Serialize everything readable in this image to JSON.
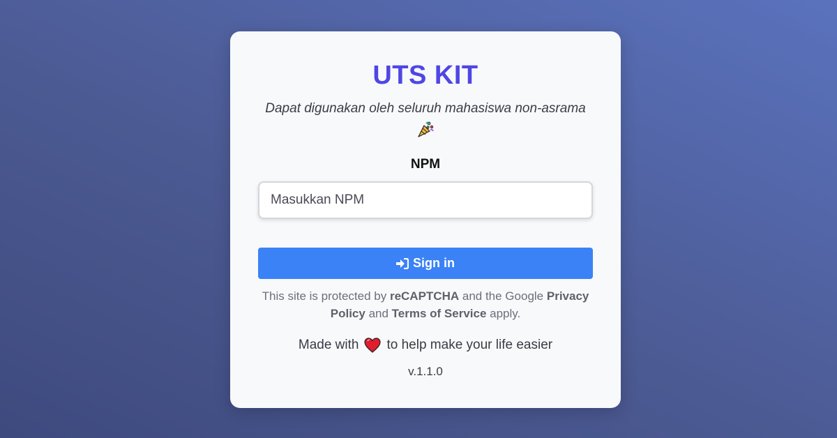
{
  "card": {
    "title": "UTS KIT",
    "subtitle": "Dapat digunakan oleh seluruh mahasiswa non-asrama",
    "subtitle_icon": "party-popper-icon",
    "npm_label": "NPM",
    "npm_placeholder": "Masukkan NPM",
    "npm_value": "",
    "signin_label": "Sign in",
    "signin_icon": "sign-in-icon",
    "recaptcha": {
      "t1": "This site is protected by ",
      "recaptcha_link": "reCAPTCHA",
      "t2": " and the Google ",
      "privacy_link": "Privacy Policy",
      "t3": " and ",
      "terms_link": "Terms of Service",
      "t4": " apply."
    },
    "made_with_prefix": "Made with",
    "made_with_icon": "heart-icon",
    "made_with_suffix": "to help make your life easier",
    "version": "v.1.1.0"
  },
  "colors": {
    "title": "#4f46e5",
    "button": "#3b82f6",
    "heart": "#e11d2e"
  }
}
